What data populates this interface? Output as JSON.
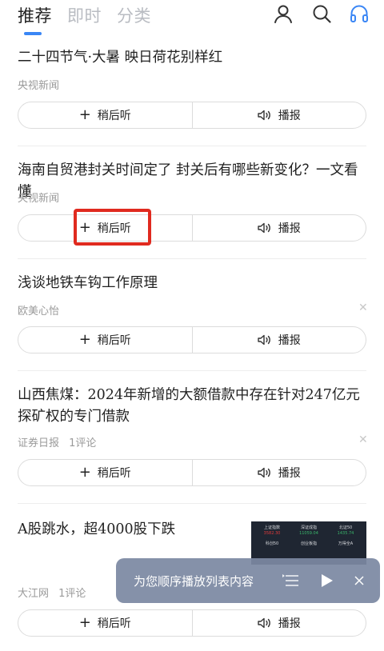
{
  "tabs": [
    {
      "label": "推荐",
      "active": true
    },
    {
      "label": "即时",
      "active": false
    },
    {
      "label": "分类",
      "active": false
    }
  ],
  "icons": {
    "user": "user-icon",
    "search": "search-icon",
    "headphones": "headphones-icon"
  },
  "colors": {
    "accent": "#3a86f5",
    "highlight": "#e02a1f",
    "toast_bg": "#7c89a2"
  },
  "actions": {
    "listen_later": "稍后听",
    "play": "播报"
  },
  "items": [
    {
      "title": "二十四节气·大暑 映日荷花别样红",
      "source": "央视新闻",
      "comments": ""
    },
    {
      "title": "海南自贸港封关时间定了 封关后有哪些新变化？一文看懂",
      "source": "央视新闻",
      "comments": ""
    },
    {
      "title": "浅谈地铁车钩工作原理",
      "source": "欧美心怡",
      "comments": ""
    },
    {
      "title": "山西焦煤：2024年新增的大额借款中存在针对247亿元探矿权的专门借款",
      "source": "证券日报",
      "comments": "1评论"
    },
    {
      "title": "A股跳水，超4000股下跌",
      "source": "大江网",
      "comments": "1评论"
    }
  ],
  "thumbnail": {
    "cells": [
      {
        "name": "上证指数",
        "value": "3582.30"
      },
      {
        "name": "深证成指",
        "value": "11059.04"
      },
      {
        "name": "北证50",
        "value": "1435.74"
      },
      {
        "name": "科创50",
        "value": ""
      },
      {
        "name": "创业板指",
        "value": ""
      },
      {
        "name": "万得全A",
        "value": ""
      }
    ]
  },
  "toast": {
    "text": "为您顺序播放列表内容"
  }
}
